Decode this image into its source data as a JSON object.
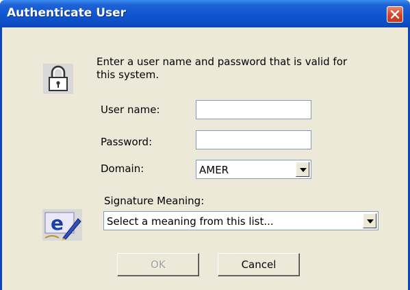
{
  "window": {
    "title": "Authenticate User",
    "close_icon": "close-icon"
  },
  "form": {
    "prompt": "Enter a user name and password that is valid for this system.",
    "user_label": "User name:",
    "user_value": "",
    "password_label": "Password:",
    "password_value": "",
    "domain_label": "Domain:",
    "domain_value": "AMER",
    "signature_label": "Signature Meaning:",
    "signature_value": "Select a meaning from this list..."
  },
  "buttons": {
    "ok_label": "OK",
    "ok_enabled": false,
    "cancel_label": "Cancel"
  },
  "icons": {
    "lock": "lock-icon",
    "signature": "e-signature-icon"
  },
  "colors": {
    "titlebar": "#0b47b8",
    "dialog_bg": "#ece9d8",
    "close_red": "#d5432a"
  }
}
